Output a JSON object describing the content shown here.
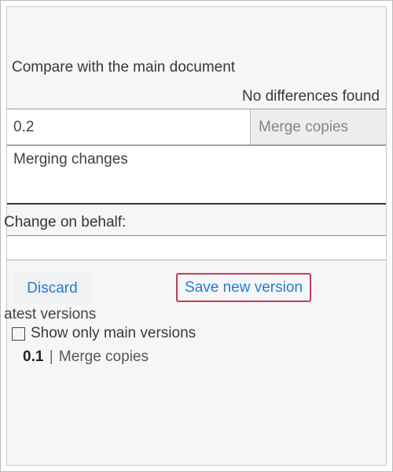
{
  "compare_label": "Compare with the main document",
  "no_differences": "No differences found",
  "version_input": "0.2",
  "merge_copies_btn": "Merge copies",
  "merging_changes": "Merging changes",
  "behalf_label": "Change on behalf:",
  "behalf_value": "",
  "discard_btn": "Discard",
  "save_btn": "Save new version",
  "latest_versions_text": "atest versions",
  "show_only_main": "Show only main versions",
  "version_row": {
    "number": "0.1",
    "separator": "|",
    "desc": "Merge copies"
  }
}
